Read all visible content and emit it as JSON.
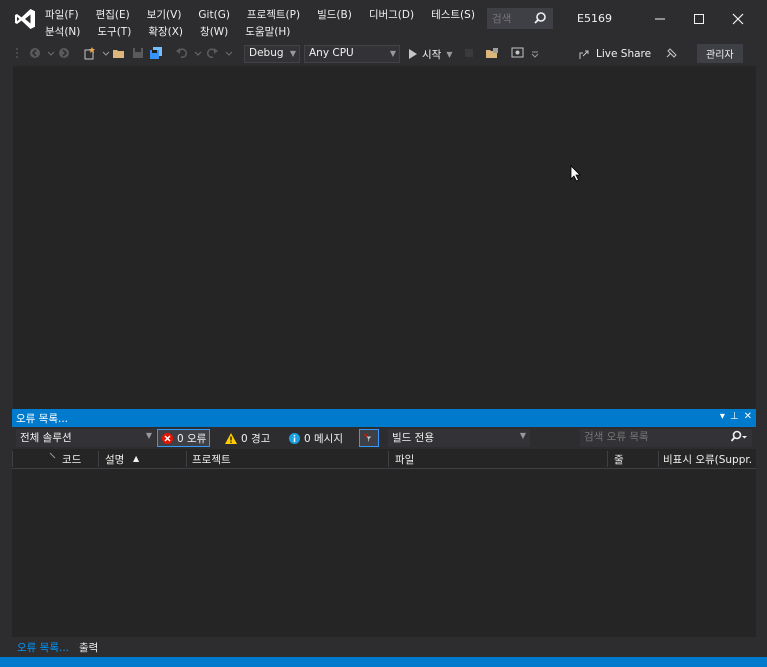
{
  "menu": {
    "row1": [
      "파일(F)",
      "편집(E)",
      "보기(V)",
      "Git(G)",
      "프로젝트(P)",
      "빌드(B)",
      "디버그(D)",
      "테스트(S)"
    ],
    "row2": [
      "분석(N)",
      "도구(T)",
      "확장(X)",
      "창(W)",
      "도움말(H)"
    ]
  },
  "search": {
    "placeholder": "검색"
  },
  "solution_name": "E5169",
  "toolbar": {
    "config": "Debug",
    "platform": "Any CPU",
    "start_label": "시작",
    "live_share": "Live Share",
    "admin_badge": "관리자"
  },
  "error_list": {
    "title": "오류 목록...",
    "scope": "전체 솔루션",
    "errors_label": "0 오류",
    "warnings_label": "0 경고",
    "messages_label": "0 메시지",
    "build_filter": "빌드 전용",
    "search_placeholder": "검색 오류 목록",
    "columns": {
      "code": "코드",
      "description": "설명",
      "project": "프로젝트",
      "file": "파일",
      "line": "줄",
      "suppression": "비표시 오류(Suppr."
    }
  },
  "bottom_tabs": [
    "오류 목록...",
    "출력"
  ],
  "colors": {
    "accent": "#007acc",
    "background": "#2d2d30",
    "editor_bg": "#252526",
    "vs_logo": "#ffffff"
  }
}
